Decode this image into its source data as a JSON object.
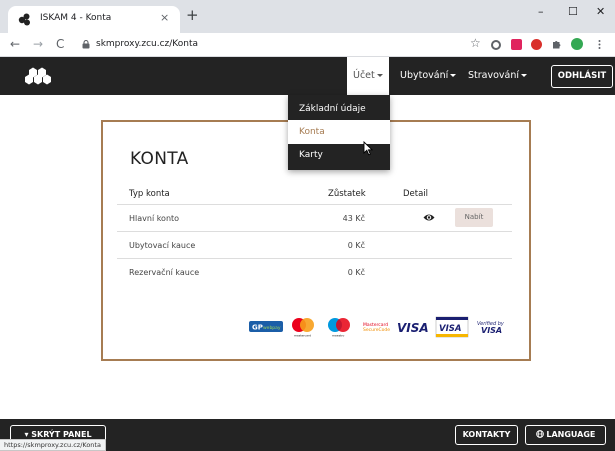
{
  "browser": {
    "tab_title": "ISKAM 4 - Konta",
    "tab_close": "×",
    "new_tab": "+",
    "win_min": "–",
    "win_max": "☐",
    "win_close": "✕",
    "nav_back": "←",
    "nav_forward": "→",
    "nav_reload": "C",
    "star": "☆",
    "url": "skmproxy.zcu.cz/Konta",
    "status_url": "https://skmproxy.zcu.cz/Konta"
  },
  "navbar": {
    "items": [
      {
        "label": "Účet",
        "active": true
      },
      {
        "label": "Ubytování",
        "active": false
      },
      {
        "label": "Stravování",
        "active": false
      }
    ],
    "logout_label": "ODHLÁSIT"
  },
  "dropdown": {
    "items": [
      {
        "label": "Základní údaje",
        "active": false
      },
      {
        "label": "Konta",
        "active": true
      },
      {
        "label": "Karty",
        "active": false
      }
    ]
  },
  "card": {
    "title": "KONTA",
    "headers": {
      "type": "Typ konta",
      "balance": "Zůstatek",
      "detail": "Detail"
    },
    "rows": [
      {
        "type": "Hlavní konto",
        "balance": "43 Kč",
        "has_detail": true,
        "pay_label": "Nabít"
      },
      {
        "type": "Ubytovací kauce",
        "balance": "0 Kč",
        "has_detail": false,
        "pay_label": ""
      },
      {
        "type": "Rezervační kauce",
        "balance": "0 Kč",
        "has_detail": false,
        "pay_label": ""
      }
    ]
  },
  "payment_logos": {
    "gp_label": "GP",
    "gp_sub": "webpay",
    "mc_label": "mastercard",
    "maestro_label": "maestro",
    "mc_secure_1": "Mastercard",
    "mc_secure_2": "SecureCode",
    "visa": "VISA",
    "visa2": "VISA",
    "verified_1": "Verified by",
    "verified_2": "VISA"
  },
  "footer": {
    "hide_panel": "▾ SKRÝT PANEL",
    "contacts": "KONTAKTY",
    "language": "LANGUAGE"
  },
  "colors": {
    "accent": "#a67c52",
    "navbar_bg": "#232323",
    "tab_strip": "#dee1e6"
  }
}
